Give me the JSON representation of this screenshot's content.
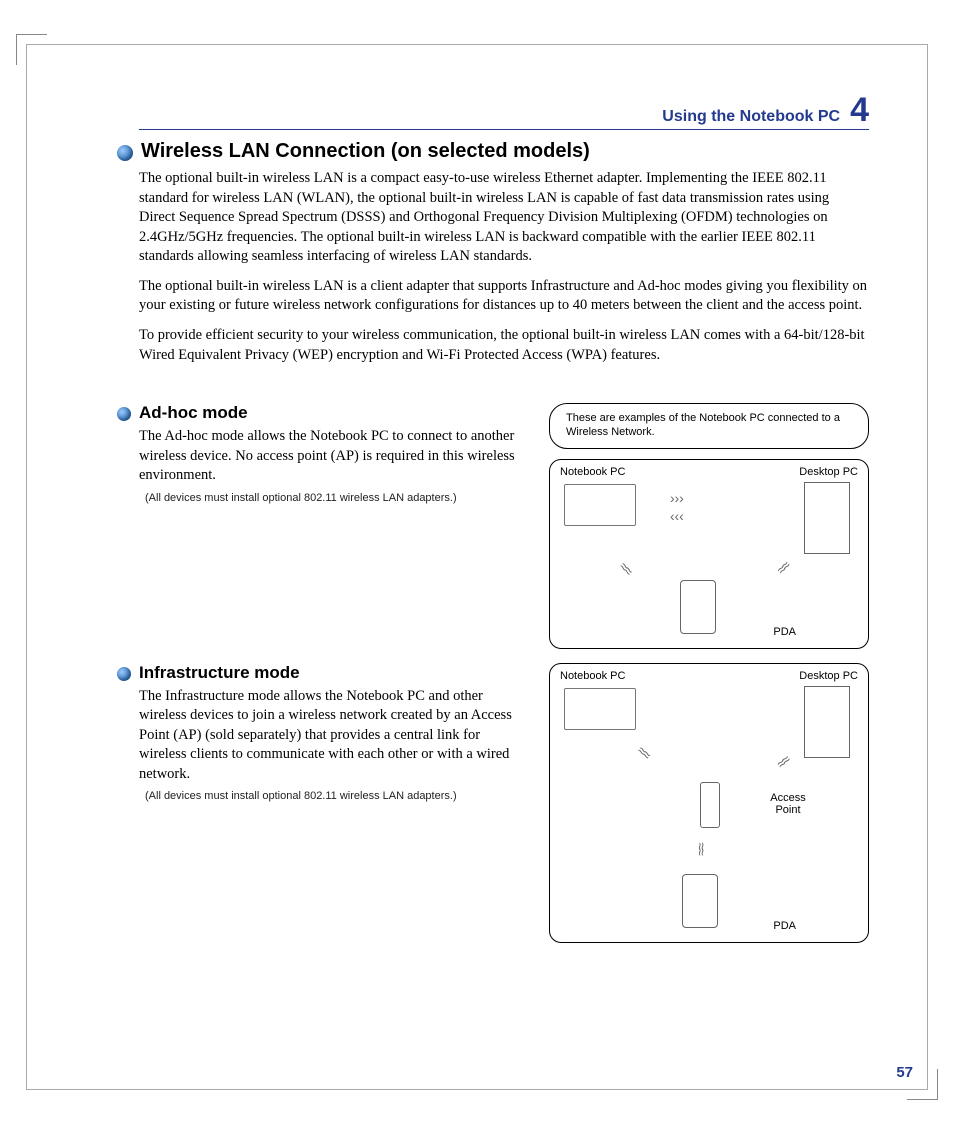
{
  "chapter": {
    "title": "Using the Notebook PC",
    "number": "4"
  },
  "h1": "Wireless LAN Connection (on selected models)",
  "p1": "The optional built-in wireless LAN is a compact easy-to-use wireless Ethernet adapter. Implementing the IEEE 802.11 standard for wireless LAN (WLAN), the optional built-in wireless LAN is capable of fast data transmission rates using Direct Sequence Spread Spectrum (DSSS) and Orthogonal Frequency Division Multiplexing (OFDM) technologies on 2.4GHz/5GHz frequencies. The optional built-in wireless LAN is backward compatible with the earlier IEEE 802.11 standards allowing seamless interfacing of wireless LAN standards.",
  "p2": "The optional built-in wireless LAN is a client adapter that supports Infrastructure and Ad-hoc modes giving you flexibility on your existing or future wireless network configurations for distances up to 40 meters between the client and the access point.",
  "p3": "To provide efficient security to your wireless communication, the optional built-in wireless LAN comes with a 64-bit/128-bit Wired Equivalent Privacy (WEP) encryption and Wi-Fi Protected Access (WPA) features.",
  "callout": "These are examples of the Notebook PC connected to a Wireless Network.",
  "adhoc": {
    "title": "Ad-hoc mode",
    "body": "The Ad-hoc mode allows the Notebook PC to connect to another wireless device. No access point (AP) is required in this wireless environment.",
    "note": "(All devices must install optional 802.11 wireless LAN adapters.)"
  },
  "infra": {
    "title": "Infrastructure mode",
    "body": "The Infrastructure mode allows the Notebook PC and other wireless devices to join a wireless network created by an Access Point (AP) (sold separately) that provides a central link for wireless clients to communicate with each other or with a wired network.",
    "note": "(All devices must install optional 802.11 wireless LAN adapters.)"
  },
  "labels": {
    "notebook": "Notebook PC",
    "desktop": "Desktop PC",
    "pda": "PDA",
    "ap": "Access Point"
  },
  "pageNumber": "57"
}
